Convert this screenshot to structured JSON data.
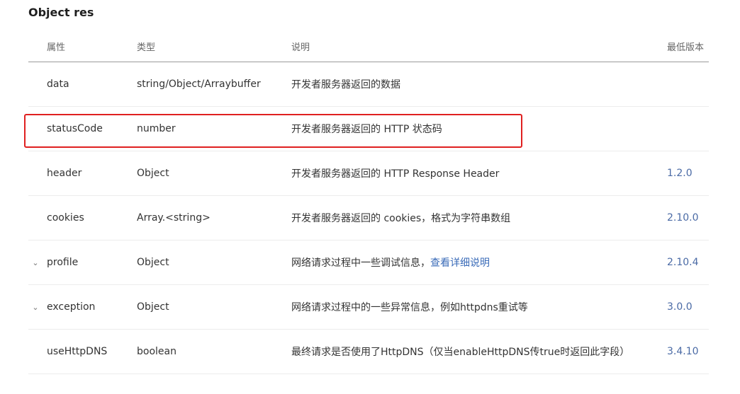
{
  "section_title": "Object res",
  "table": {
    "headers": {
      "name": "属性",
      "type": "类型",
      "desc": "说明",
      "version": "最低版本"
    },
    "rows": [
      {
        "expandable": false,
        "name": "data",
        "type": "string/Object/Arraybuffer",
        "desc": "开发者服务器返回的数据",
        "desc_link": "",
        "version": ""
      },
      {
        "expandable": false,
        "name": "statusCode",
        "type": "number",
        "desc": "开发者服务器返回的 HTTP 状态码",
        "desc_link": "",
        "version": ""
      },
      {
        "expandable": false,
        "name": "header",
        "type": "Object",
        "desc": "开发者服务器返回的 HTTP Response Header",
        "desc_link": "",
        "version": "1.2.0"
      },
      {
        "expandable": false,
        "name": "cookies",
        "type": "Array.<string>",
        "desc": "开发者服务器返回的 cookies，格式为字符串数组",
        "desc_link": "",
        "version": "2.10.0"
      },
      {
        "expandable": true,
        "name": "profile",
        "type": "Object",
        "desc": "网络请求过程中一些调试信息，",
        "desc_link": "查看详细说明",
        "version": "2.10.4"
      },
      {
        "expandable": true,
        "name": "exception",
        "type": "Object",
        "desc": "网络请求过程中的一些异常信息，例如httpdns重试等",
        "desc_link": "",
        "version": "3.0.0"
      },
      {
        "expandable": false,
        "name": "useHttpDNS",
        "type": "boolean",
        "desc": "最终请求是否使用了HttpDNS（仅当enableHttpDNS传true时返回此字段）",
        "desc_link": "",
        "version": "3.4.10"
      }
    ]
  },
  "highlight": {
    "row": "statusCode",
    "color": "#e02020"
  },
  "icons": {
    "expand": "chevron-down-icon",
    "expand_glyph": "⌄"
  }
}
